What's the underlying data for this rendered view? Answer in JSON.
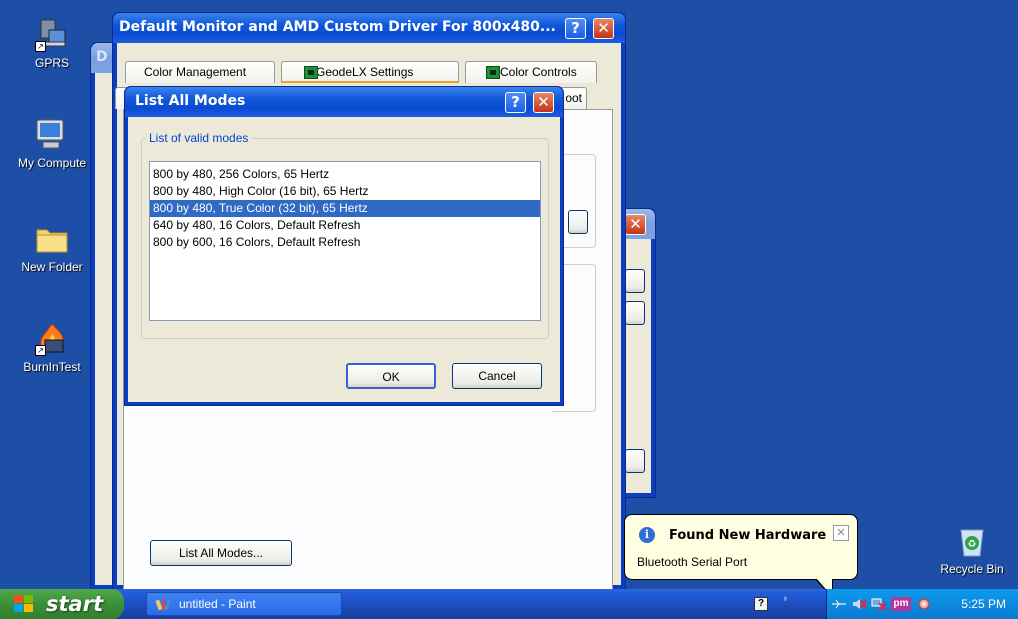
{
  "desktop": {
    "icons": [
      {
        "label": "GPRS"
      },
      {
        "label": "My Compute"
      },
      {
        "label": "New Folder"
      },
      {
        "label": "BurnInTest"
      },
      {
        "label": "Recycle Bin"
      }
    ]
  },
  "back_window_1": {
    "title_fragment": "D"
  },
  "main_window": {
    "title": "Default Monitor and AMD Custom Driver For 800x480...",
    "tabs": [
      {
        "label": "Color Management",
        "icon": "none"
      },
      {
        "label": "GeodeLX Settings",
        "icon": "geode-icon"
      },
      {
        "label": "Color Controls",
        "icon": "geode-icon"
      }
    ],
    "tab_row2_fragment": "oot",
    "list_all_modes_button": "List All Modes..."
  },
  "modal": {
    "title": "List All Modes",
    "group_label": "List of valid modes",
    "modes": [
      "800 by 480, 256 Colors, 65 Hertz",
      "800 by 480, High Color (16 bit), 65 Hertz",
      "800 by 480, True Color (32 bit), 65 Hertz",
      "640 by 480, 16 Colors, Default Refresh",
      "800 by 600, 16 Colors, Default Refresh"
    ],
    "selected_index": 2,
    "ok_label": "OK",
    "cancel_label": "Cancel"
  },
  "balloon": {
    "title": "Found New Hardware",
    "text": "Bluetooth Serial Port",
    "close_glyph": "✕"
  },
  "taskbar": {
    "start_label": "start",
    "tasks": [
      {
        "label": "untitled - Paint"
      }
    ],
    "clock": "5:25 PM",
    "tray_pm_label": "pm"
  },
  "colors": {
    "desktop_bg": "#1e4fa6",
    "selection": "#316ac5",
    "title_active": "#0b4bd2",
    "group_label": "#0046d5"
  }
}
